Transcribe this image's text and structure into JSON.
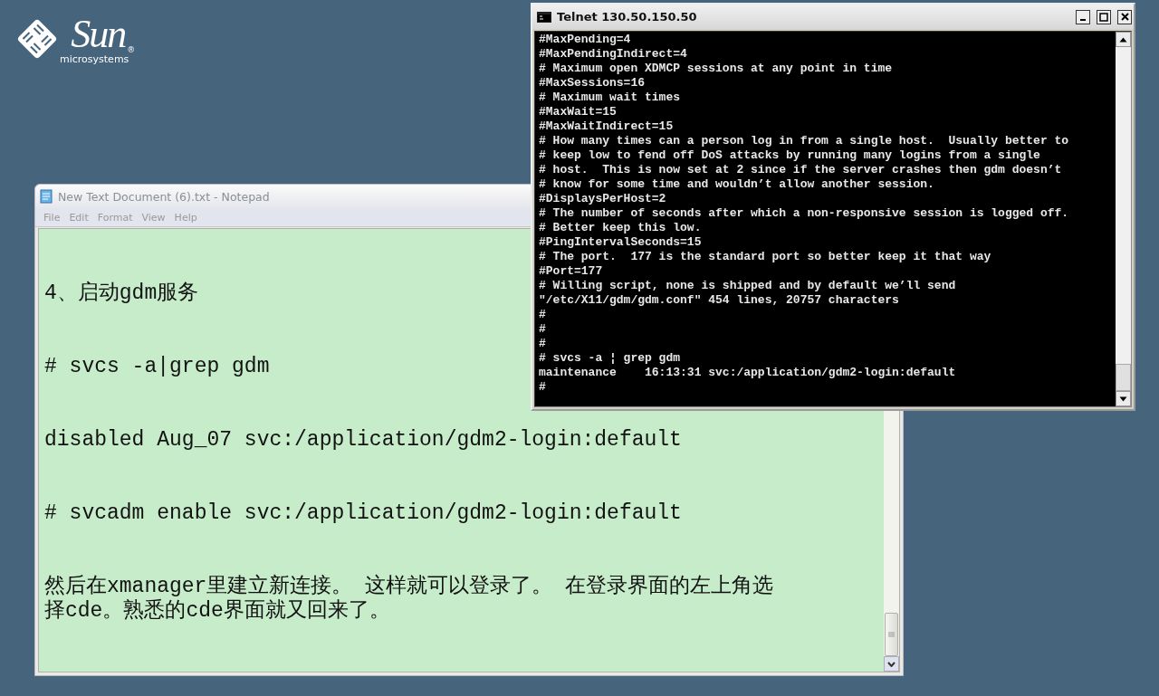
{
  "logo": {
    "name": "Sun",
    "registered": "®",
    "tagline": "microsystems"
  },
  "notepad": {
    "title": "New Text Document (6).txt - Notepad",
    "menu": [
      "File",
      "Edit",
      "Format",
      "View",
      "Help"
    ],
    "paragraphs": [
      {
        "lines": [
          "4、启动gdm服务"
        ]
      },
      {
        "lines": [
          "# svcs -a|grep gdm"
        ]
      },
      {
        "lines": [
          "disabled Aug_07 svc:/application/gdm2-login:default"
        ]
      },
      {
        "lines": [
          "# svcadm enable svc:/application/gdm2-login:default"
        ]
      },
      {
        "lines": [
          "然后在xmanager里建立新连接。 这样就可以登录了。 在登录界面的左上角选",
          "择cde。熟悉的cde界面就又回来了。"
        ]
      }
    ]
  },
  "telnet": {
    "title": "Telnet 130.50.150.50",
    "lines": [
      "#MaxPending=4",
      "#MaxPendingIndirect=4",
      "# Maximum open XDMCP sessions at any point in time",
      "#MaxSessions=16",
      "# Maximum wait times",
      "#MaxWait=15",
      "#MaxWaitIndirect=15",
      "# How many times can a person log in from a single host.  Usually better to",
      "# keep low to fend off DoS attacks by running many logins from a single",
      "# host.  This is now set at 2 since if the server crashes then gdm doesn’t",
      "# know for some time and wouldn’t allow another session.",
      "#DisplaysPerHost=2",
      "# The number of seconds after which a non-responsive session is logged off.",
      "# Better keep this low.",
      "#PingIntervalSeconds=15",
      "# The port.  177 is the standard port so better keep it that way",
      "#Port=177",
      "# Willing script, none is shipped and by default we’ll send",
      "\"/etc/X11/gdm/gdm.conf\" 454 lines, 20757 characters",
      "#",
      "#",
      "#",
      "# svcs -a ¦ grep gdm",
      "maintenance    16:13:31 svc:/application/gdm2-login:default",
      "#"
    ]
  }
}
